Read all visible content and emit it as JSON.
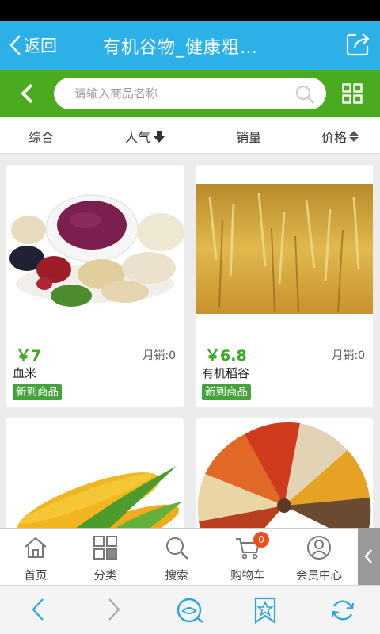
{
  "titlebar": {
    "back_label": "返回",
    "title": "有机谷物_健康粗…"
  },
  "search": {
    "placeholder": "请输入商品名称"
  },
  "sort": {
    "items": [
      "综合",
      "人气",
      "销量",
      "价格"
    ]
  },
  "products": [
    {
      "price": "￥7",
      "sales": "月销:0",
      "name": "血米",
      "badge": "新到商品"
    },
    {
      "price": "￥6.8",
      "sales": "月销:0",
      "name": "有机稻谷",
      "badge": "新到商品"
    }
  ],
  "tabbar": {
    "items": [
      "首页",
      "分类",
      "搜索",
      "购物车",
      "会员中心"
    ],
    "cart_count": "0"
  },
  "colors": {
    "titlebar": "#2bb0e8",
    "searchbar": "#4aab1f",
    "price": "#3da822",
    "badge": "#44a33a",
    "cart_badge": "#f04a1d",
    "browser_icon": "#2aa6dd"
  }
}
